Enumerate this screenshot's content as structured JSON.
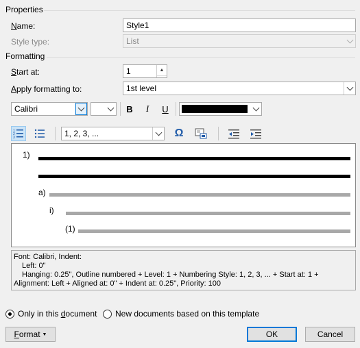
{
  "properties": {
    "section_title": "Properties",
    "name_label": "Name:",
    "name_value": "Style1",
    "style_type_label": "Style type:",
    "style_type_value": "List"
  },
  "formatting": {
    "section_title": "Formatting",
    "start_at_label": "Start at:",
    "start_at_value": "1",
    "apply_label": "Apply formatting to:",
    "apply_value": "1st level",
    "font_value": "Calibri",
    "size_value": "",
    "bold": "B",
    "italic": "I",
    "underline": "U",
    "font_color": "#000000",
    "number_style_value": "1, 2, 3, ...",
    "symbol_glyph": "Ω"
  },
  "preview": {
    "level1": "1)",
    "level2": "a)",
    "level3": "i)",
    "level4": "(1)"
  },
  "description": {
    "line1": "Font: Calibri, Indent:",
    "line2": "Left:  0\"",
    "line3": "Hanging:  0.25\", Outline numbered + Level: 1 + Numbering Style: 1, 2, 3, ... + Start at: 1 +",
    "line4": "Alignment: Left + Aligned at:  0\" + Indent at:  0.25\", Priority: 100"
  },
  "scope": {
    "only_doc_label": "Only in this document",
    "new_docs_label": "New documents based on this template",
    "selected": "only_doc"
  },
  "buttons": {
    "format_label": "Format",
    "ok_label": "OK",
    "cancel_label": "Cancel"
  }
}
